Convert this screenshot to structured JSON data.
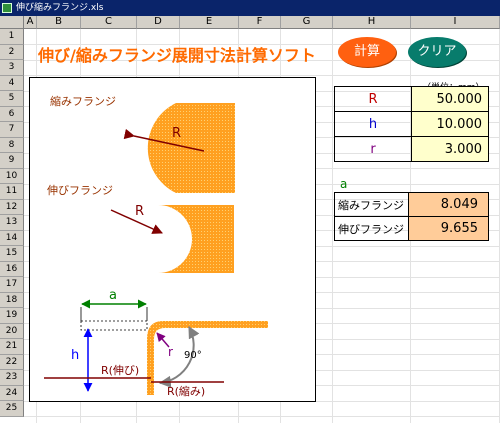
{
  "window": {
    "title": "伸び縮みフランジ.xls"
  },
  "columns": [
    "A",
    "B",
    "C",
    "D",
    "E",
    "F",
    "G",
    "H",
    "I"
  ],
  "rows": [
    "1",
    "2",
    "3",
    "4",
    "5",
    "6",
    "7",
    "8",
    "9",
    "10",
    "11",
    "12",
    "13",
    "14",
    "15",
    "16",
    "17",
    "18",
    "19",
    "20",
    "21",
    "22",
    "23",
    "24",
    "25"
  ],
  "app": {
    "title": "伸び/縮みフランジ展開寸法計算ソフト",
    "calc_button": "計算",
    "clear_button": "クリア"
  },
  "params": {
    "unit": "（単位：mm）",
    "rows": [
      {
        "label": "R",
        "value": "50.000",
        "color": "#c00000"
      },
      {
        "label": "h",
        "value": "10.000",
        "color": "#0000cc"
      },
      {
        "label": "r",
        "value": "3.000",
        "color": "#800080"
      }
    ]
  },
  "results": {
    "label": "a",
    "rows": [
      {
        "label": "縮みフランジ",
        "value": "8.049"
      },
      {
        "label": "伸びフランジ",
        "value": "9.655"
      }
    ]
  },
  "diagram": {
    "shrink_label": "縮みフランジ",
    "stretch_label": "伸びフランジ",
    "R": "R",
    "a": "a",
    "h": "h",
    "r": "r",
    "angle": "90°",
    "r_stretch": "R(伸び)",
    "r_shrink": "R(縮み)"
  }
}
